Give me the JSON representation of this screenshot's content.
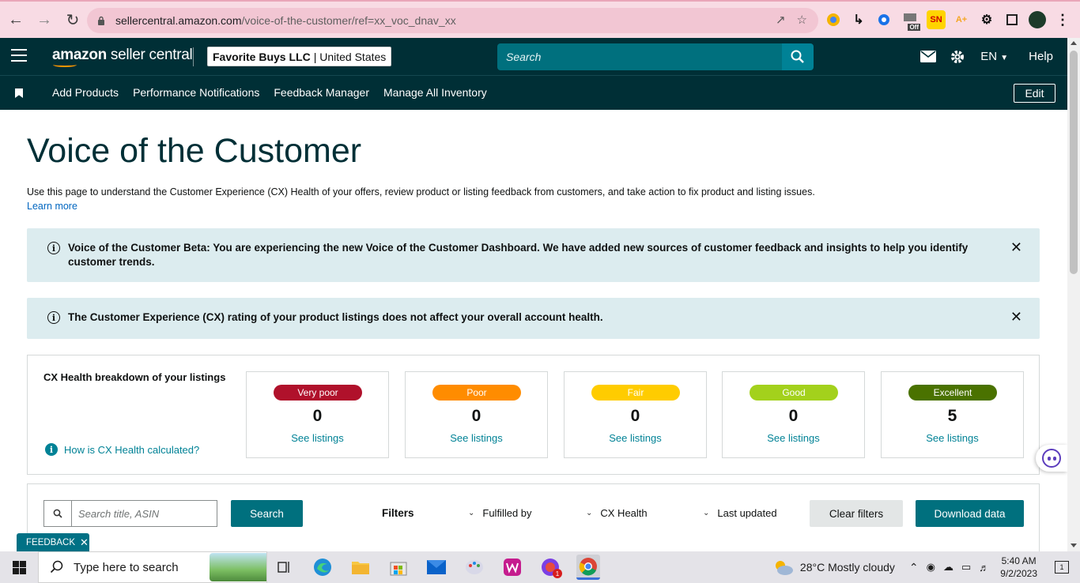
{
  "browser": {
    "url_host": "sellercentral.amazon.com",
    "url_path": "/voice-of-the-customer/ref=xx_voc_dnav_xx",
    "extensions": [
      {
        "name": "color-wheel-ext",
        "label": ""
      },
      {
        "name": "arrow-ext",
        "label": ""
      },
      {
        "name": "grid-ext",
        "label": ""
      },
      {
        "name": "off-ext",
        "label": "Off"
      },
      {
        "name": "sn-ext",
        "label": "SN"
      },
      {
        "name": "scout-ext",
        "label": "A+"
      },
      {
        "name": "puzzle-ext",
        "label": ""
      }
    ]
  },
  "header": {
    "brand_bold": "amazon",
    "brand_rest": " seller central",
    "store_name": "Favorite Buys LLC",
    "store_region": "| United States",
    "search_placeholder": "Search",
    "lang": "EN",
    "help": "Help"
  },
  "nav": {
    "links": [
      "Add Products",
      "Performance Notifications",
      "Feedback Manager",
      "Manage All Inventory"
    ],
    "edit": "Edit"
  },
  "page": {
    "title": "Voice of the Customer",
    "intro": "Use this page to understand the Customer Experience (CX) Health of your offers, review product or listing feedback from customers, and take action to fix product and listing issues.",
    "learn_more": "Learn more",
    "alert1": "Voice of the Customer Beta: You are experiencing the new Voice of the Customer Dashboard. We have added new sources of customer feedback and insights to help you identify customer trends.",
    "alert2": "The Customer Experience (CX) rating of your product listings does not affect your overall account health."
  },
  "cx": {
    "title": "CX Health breakdown of your listings",
    "help": "How is CX Health calculated?",
    "cards": [
      {
        "label": "Very poor",
        "count": "0",
        "link": "See listings",
        "color": "#b0112b",
        "text_color": "#ffffff"
      },
      {
        "label": "Poor",
        "count": "0",
        "link": "See listings",
        "color": "#ff8c00",
        "text_color": "#ffffff"
      },
      {
        "label": "Fair",
        "count": "0",
        "link": "See listings",
        "color": "#ffcc00",
        "text_color": "#ffffff"
      },
      {
        "label": "Good",
        "count": "0",
        "link": "See listings",
        "color": "#a3d11c",
        "text_color": "#ffffff"
      },
      {
        "label": "Excellent",
        "count": "5",
        "link": "See listings",
        "color": "#4a7200",
        "text_color": "#ffffff"
      }
    ]
  },
  "filters": {
    "search_placeholder": "Search title, ASIN",
    "search_button": "Search",
    "filters_label": "Filters",
    "dropdowns": [
      "Fulfilled by",
      "CX Health",
      "Last updated"
    ],
    "clear": "Clear filters",
    "download": "Download data"
  },
  "feedback_tab": "FEEDBACK",
  "taskbar": {
    "search_placeholder": "Type here to search",
    "weather": "28°C  Mostly cloudy",
    "time": "5:40 AM",
    "date": "9/2/2023",
    "notifications": "1"
  }
}
